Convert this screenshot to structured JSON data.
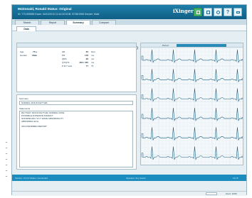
{
  "titlebar": {
    "patient": "McDonald, Ronald  Status: Original",
    "meta": "ID: 773-555555   Exam: 04/12/2010 11:44:33   DOB: 07/08/1965   Gender: Male",
    "brand": "iXinger"
  },
  "tabs": [
    "Search",
    "Report",
    "Summary",
    "Compare"
  ],
  "active_tab": "Summary",
  "subtab": "Data",
  "toolbar": {
    "select1": "Period",
    "select2": "Default Printer",
    "page": "Page 1/1"
  },
  "measurements": {
    "col1": [
      {
        "label": "Age",
        "value": "76 y"
      },
      {
        "label": "Gender",
        "value": "Male"
      }
    ],
    "col2": [
      {
        "label": "HR",
        "value": "66",
        "unit": "bpm"
      },
      {
        "label": "PR",
        "value": "178",
        "unit": "ms"
      },
      {
        "label": "QRS",
        "value": "96",
        "unit": "ms"
      },
      {
        "label": "QT/QTc",
        "value": "384 / 405",
        "unit": "ms"
      },
      {
        "label": "P-R-T axis",
        "value": "77",
        "unit": "73"
      }
    ]
  },
  "summary_label": "Summary",
  "summary_value": "NORMAL SINUS RHYTHM",
  "statements_label": "Statements",
  "statements": [
    "RHYTHM: SINUS RHYTHM, NORMAL RATE",
    "POSSIBLE ANTERIOR INFARCT",
    "NONSPECIFIC ST-T WAVE ABNORMALITY",
    "ABNORMAL ECG",
    "UNCONFIRMED REPORT"
  ],
  "ecg_header": {
    "label": "Period"
  },
  "statusbar": {
    "left": "Version: V1.0.0   Status: Connected",
    "center": "Operator: Any doctor",
    "right": "14:15"
  },
  "bottom_strip": {
    "left": "",
    "right": "Zoom: 100%"
  },
  "colors": {
    "accent": "#1e7ea8",
    "trace": "#1f5f7f",
    "status": "#1a8cbd"
  },
  "icons": [
    "report-icon",
    "compare-icon",
    "settings-icon",
    "help-icon",
    "exit-icon"
  ]
}
